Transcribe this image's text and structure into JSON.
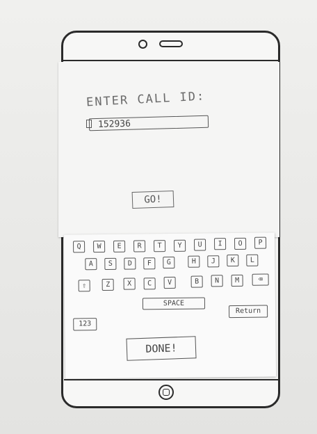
{
  "screen": {
    "label": "ENTER CALL ID:",
    "call_id_value": "152936",
    "go_label": "GO!"
  },
  "keyboard": {
    "row1": [
      "Q",
      "W",
      "E",
      "R",
      "T",
      "Y",
      "U",
      "I",
      "O",
      "P"
    ],
    "row2": [
      "A",
      "S",
      "D",
      "F",
      "G",
      "H",
      "J",
      "K",
      "L"
    ],
    "row3": [
      "⇧",
      "Z",
      "X",
      "C",
      "V",
      "B",
      "N",
      "M",
      "⌫"
    ],
    "space_label": "SPACE",
    "return_label": "Return",
    "num_label": "123",
    "done_label": "DONE!"
  }
}
